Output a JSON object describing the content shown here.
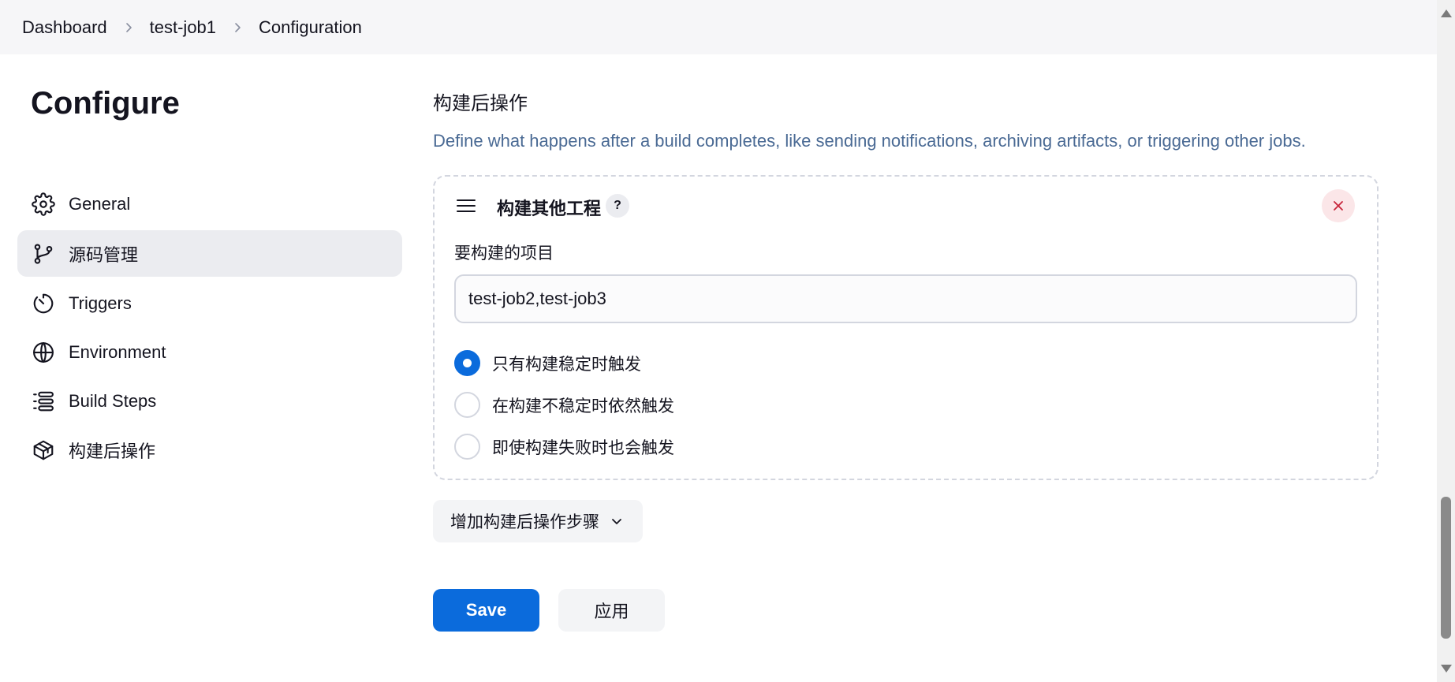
{
  "breadcrumb": {
    "items": [
      "Dashboard",
      "test-job1",
      "Configuration"
    ]
  },
  "sidebar": {
    "title": "Configure",
    "items": [
      {
        "label": "General",
        "icon": "gear-icon",
        "active": false
      },
      {
        "label": "源码管理",
        "icon": "git-branch-icon",
        "active": true
      },
      {
        "label": "Triggers",
        "icon": "timer-icon",
        "active": false
      },
      {
        "label": "Environment",
        "icon": "globe-icon",
        "active": false
      },
      {
        "label": "Build Steps",
        "icon": "list-icon",
        "active": false
      },
      {
        "label": "构建后操作",
        "icon": "package-icon",
        "active": false
      }
    ]
  },
  "main": {
    "section_heading": "构建后操作",
    "section_description": "Define what happens after a build completes, like sending notifications, archiving artifacts, or triggering other jobs.",
    "step": {
      "title": "构建其他工程",
      "help_label": "?",
      "field_label": "要构建的项目",
      "field_value": "test-job2,test-job3",
      "options": [
        {
          "label": "只有构建稳定时触发",
          "checked": true
        },
        {
          "label": "在构建不稳定时依然触发",
          "checked": false
        },
        {
          "label": "即使构建失败时也会触发",
          "checked": false
        }
      ]
    },
    "add_step_label": "增加构建后操作步骤",
    "save_label": "Save",
    "apply_label": "应用"
  },
  "colors": {
    "accent": "#0b6bdc",
    "description": "#4a6a94",
    "close_icon": "#c7243a",
    "active_nav_bg": "#ebecf0"
  }
}
